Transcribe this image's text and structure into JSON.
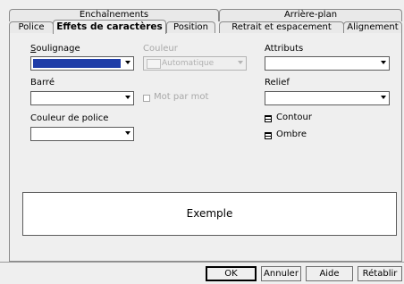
{
  "tabs_row1": [
    {
      "label": "Enchaînements"
    },
    {
      "label": "Arrière-plan"
    }
  ],
  "tabs_row2": [
    {
      "label": "Police"
    },
    {
      "label": "Effets de caractères"
    },
    {
      "label": "Position"
    },
    {
      "label": "Retrait et espacement"
    },
    {
      "label": "Alignement"
    }
  ],
  "active_tab": "Effets de caractères",
  "underline": {
    "label": "Soulignage",
    "color_label": "Couleur",
    "color_value": "Automatique",
    "swatch_color": "#1f3da8"
  },
  "strikethrough": {
    "label": "Barré",
    "word_by_word": "Mot par mot"
  },
  "font_color": {
    "label": "Couleur de police"
  },
  "attributes": {
    "label": "Attributs"
  },
  "relief": {
    "label": "Relief"
  },
  "contour": {
    "label": "Contour",
    "checked": true
  },
  "shadow": {
    "label": "Ombre",
    "checked": true
  },
  "preview": {
    "text": "Exemple"
  },
  "buttons": {
    "ok": "OK",
    "cancel": "Annuler",
    "help": "Aide",
    "reset": "Rétablir"
  }
}
